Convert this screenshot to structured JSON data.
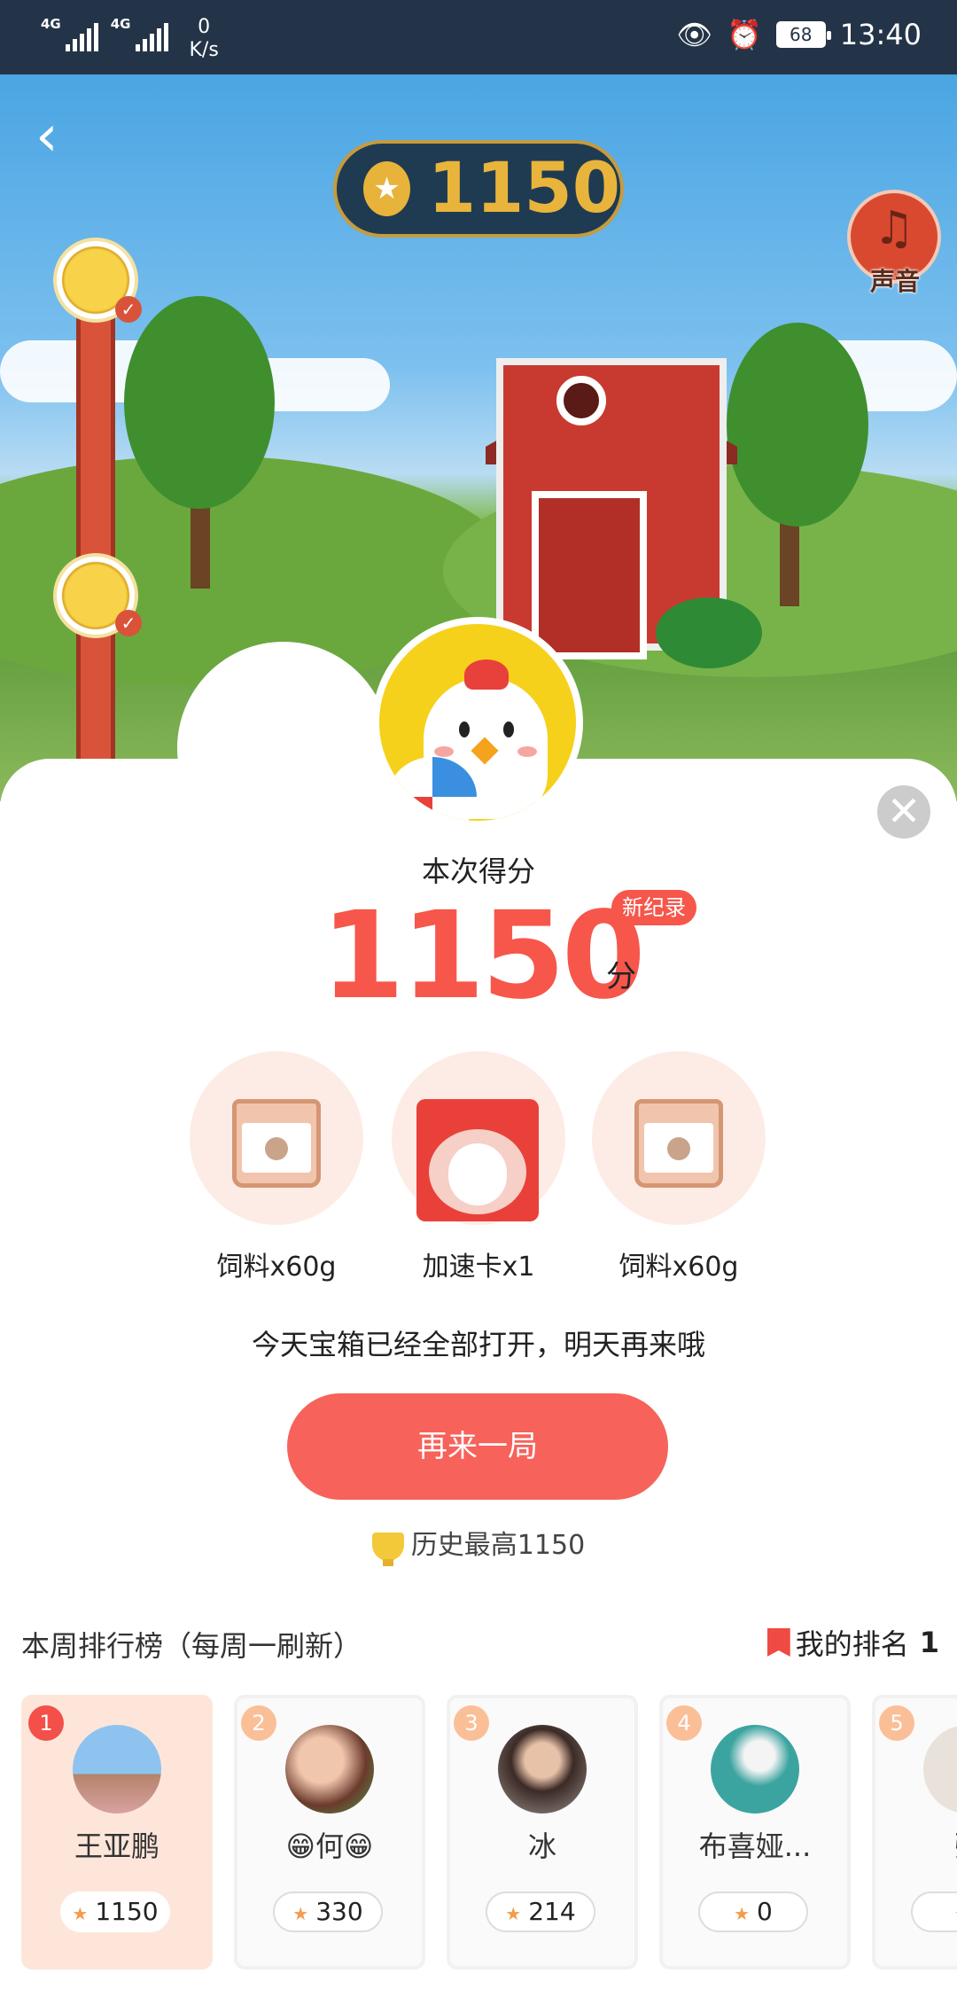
{
  "status_bar": {
    "signal1_label": "4G",
    "signal2_label": "4G",
    "speed_value": "0",
    "speed_unit": "K/s",
    "battery": "68",
    "time": "13:40"
  },
  "game": {
    "coin_score": "1150",
    "sound_label": "声音"
  },
  "result": {
    "score_title": "本次得分",
    "score": "1150",
    "unit": "分",
    "record_badge": "新纪录",
    "rewards": [
      {
        "icon": "feed-bag-icon",
        "label": "饲料x60g"
      },
      {
        "icon": "speed-card-icon",
        "label": "加速卡x1"
      },
      {
        "icon": "feed-bag-icon",
        "label": "饲料x60g"
      }
    ],
    "notice": "今天宝箱已经全部打开，明天再来哦",
    "again_button": "再来一局",
    "history_best": "历史最高1150"
  },
  "leaderboard": {
    "title": "本周排行榜（每周一刷新）",
    "my_rank_label": "我的排名",
    "my_rank_value": "1",
    "entries": [
      {
        "rank": "1",
        "name": "王亚鹏",
        "score": "1150"
      },
      {
        "rank": "2",
        "name": "😁何😁",
        "score": "330"
      },
      {
        "rank": "3",
        "name": "冰",
        "score": "214"
      },
      {
        "rank": "4",
        "name": "布喜娅...",
        "score": "0"
      },
      {
        "rank": "5",
        "name": "张",
        "score": ""
      }
    ]
  },
  "colors": {
    "accent": "#f7564b",
    "button": "#f7625a",
    "status_bar": "#243448"
  }
}
